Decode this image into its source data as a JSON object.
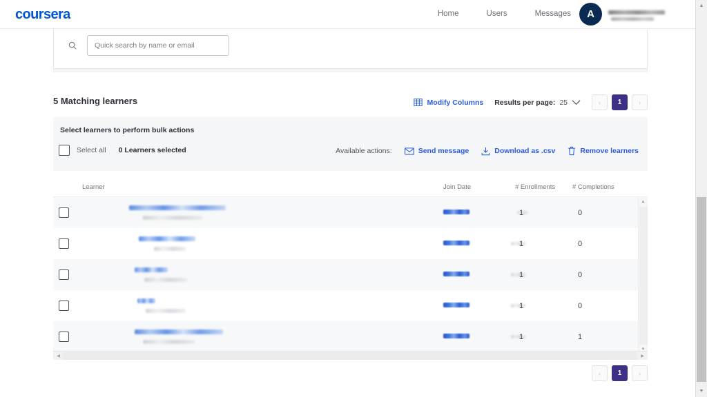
{
  "nav": {
    "logo": "coursera",
    "links": [
      {
        "label": "Home"
      },
      {
        "label": "Users"
      },
      {
        "label": "Messages"
      }
    ],
    "avatar_initial": "A"
  },
  "search": {
    "placeholder": "Quick search by name or email",
    "value": "",
    "icon": "search-icon"
  },
  "results": {
    "title": "5 Matching learners",
    "modify_columns": "Modify Columns",
    "results_per_page_label": "Results per page:",
    "results_per_page_value": "25",
    "pager": {
      "prev": "‹",
      "next": "›",
      "current_page": "1"
    }
  },
  "bulk": {
    "title": "Select learners to perform bulk actions",
    "select_all": "Select all",
    "selected_count": "0 Learners selected",
    "available_actions_label": "Available actions:",
    "actions": [
      {
        "label": "Send message",
        "icon": "envelope-icon"
      },
      {
        "label": "Download as .csv",
        "icon": "download-icon"
      },
      {
        "label": "Remove learners",
        "icon": "trash-icon"
      }
    ]
  },
  "table": {
    "columns": [
      "Learner",
      "Join Date",
      "# Enrollments",
      "# Completions"
    ],
    "rows": [
      {
        "enrollments": "1",
        "completions": "0"
      },
      {
        "enrollments": "1",
        "completions": "0"
      },
      {
        "enrollments": "1",
        "completions": "0"
      },
      {
        "enrollments": "1",
        "completions": "0"
      },
      {
        "enrollments": "1",
        "completions": "1"
      }
    ]
  },
  "colors": {
    "brand_blue": "#0056D2",
    "link_blue": "#2a5bd7",
    "pager_active": "#3C3186",
    "avatar_navy": "#0b2a52",
    "bulk_bg": "#f5f6f8"
  }
}
